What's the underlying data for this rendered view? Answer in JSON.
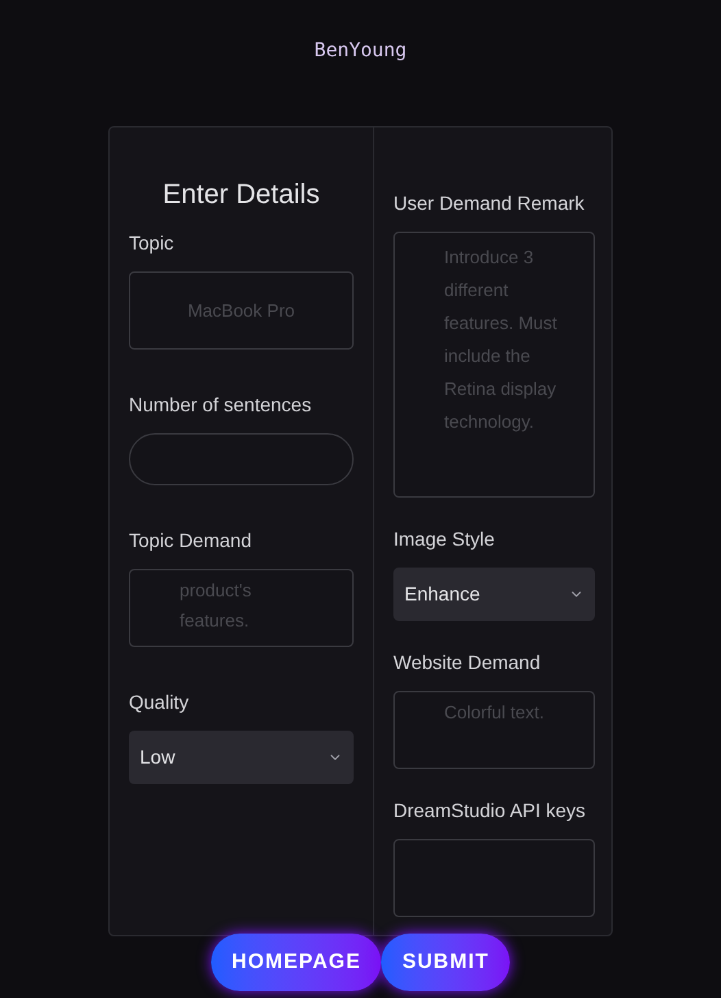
{
  "brand": "BenYoung",
  "left": {
    "heading": "Enter Details",
    "fields": [
      {
        "kind": "input",
        "label": "Topic",
        "placeholder": "MacBook Pro"
      },
      {
        "kind": "pill",
        "label": "Number of sentences"
      },
      {
        "kind": "textarea",
        "label": "Topic Demand",
        "placeholder": "product's features."
      },
      {
        "kind": "select",
        "label": "Quality",
        "value": "Low"
      }
    ]
  },
  "right": {
    "fields": [
      {
        "kind": "textarea",
        "label": "User Demand Remark",
        "placeholder": "Introduce 3 different features. Must include the Retina display technology."
      },
      {
        "kind": "select",
        "label": "Image Style",
        "value": "Enhance"
      },
      {
        "kind": "textarea",
        "label": "Website Demand",
        "placeholder": "Colorful text."
      },
      {
        "kind": "input",
        "label": "DreamStudio API keys"
      }
    ]
  },
  "buttons": [
    "HOMEPAGE",
    "SUBMIT"
  ]
}
